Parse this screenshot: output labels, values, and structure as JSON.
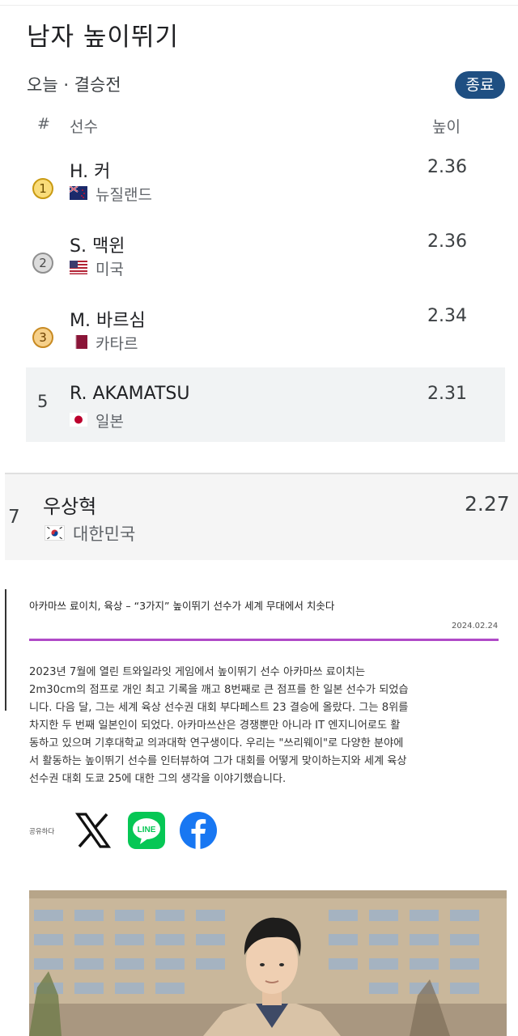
{
  "event": {
    "title": "남자 높이뛰기",
    "subtitle": "오늘 · 결승전",
    "status": "종료"
  },
  "table": {
    "headers": {
      "rank": "#",
      "athlete": "선수",
      "height": "높이"
    },
    "rows": [
      {
        "rank": "1",
        "medal": "gold",
        "athlete": "H. 커",
        "country": "뉴질랜드",
        "flag": "new-zealand-flag",
        "height": "2.36"
      },
      {
        "rank": "2",
        "medal": "silver",
        "athlete": "S. 맥윈",
        "country": "미국",
        "flag": "usa-flag",
        "height": "2.36"
      },
      {
        "rank": "3",
        "medal": "bronze",
        "athlete": "M. 바르심",
        "country": "카타르",
        "flag": "qatar-flag",
        "height": "2.34"
      },
      {
        "rank": "5",
        "medal": "",
        "athlete": "R. AKAMATSU",
        "country": "일본",
        "flag": "japan-flag",
        "height": "2.31",
        "highlighted": true
      }
    ]
  },
  "korea_row": {
    "rank": "7",
    "athlete": "우상혁",
    "country": "대한민국",
    "flag": "korea-flag",
    "height": "2.27"
  },
  "article": {
    "title": "아카마쓰 료이치, 육상 – “3가지” 높이뛰기 선수가 세계 무대에서 치솟다",
    "date": "2024.02.24",
    "accent_color": "#b04ac7",
    "body_lines": [
      "2023년 7월에 열린 트와일라잇 게임에서 높이뛰기 선수 아카마쓰 료이치는",
      "2m30cm의 점프로 개인 최고 기록을 깨고 8번째로 큰 점프를 한 일본 선수가 되었습",
      "니다. 다음 달, 그는 세계 육상 선수권 대회 부다페스트 23 결승에 올랐다. 그는 8위를",
      "차지한 두 번째 일본인이 되었다. 아카마쓰산은 경쟁뿐만 아니라 IT 엔지니어로도 활",
      "동하고 있으며 기후대학교 의과대학 연구생이다. 우리는 \"쓰리웨이\"로 다양한 분야에",
      "서 활동하는 높이뛰기 선수를 인터뷰하여 그가 대회를 어떻게 맞이하는지와 세계 육상",
      "선수권 대회 도쿄 25에 대한 그의 생각을 이야기했습니다."
    ],
    "share_label": "공유하다",
    "share_icons": [
      "x-icon",
      "line-icon",
      "facebook-icon"
    ],
    "line_label": "LINE"
  },
  "colors": {
    "status_bg": "#1f4f82",
    "highlight_row": "#f1f3f4",
    "gold": "#f9dc7a",
    "silver": "#dcdcdc",
    "bronze": "#f6d08a",
    "line_green": "#06c755",
    "facebook_blue": "#1877f2"
  }
}
